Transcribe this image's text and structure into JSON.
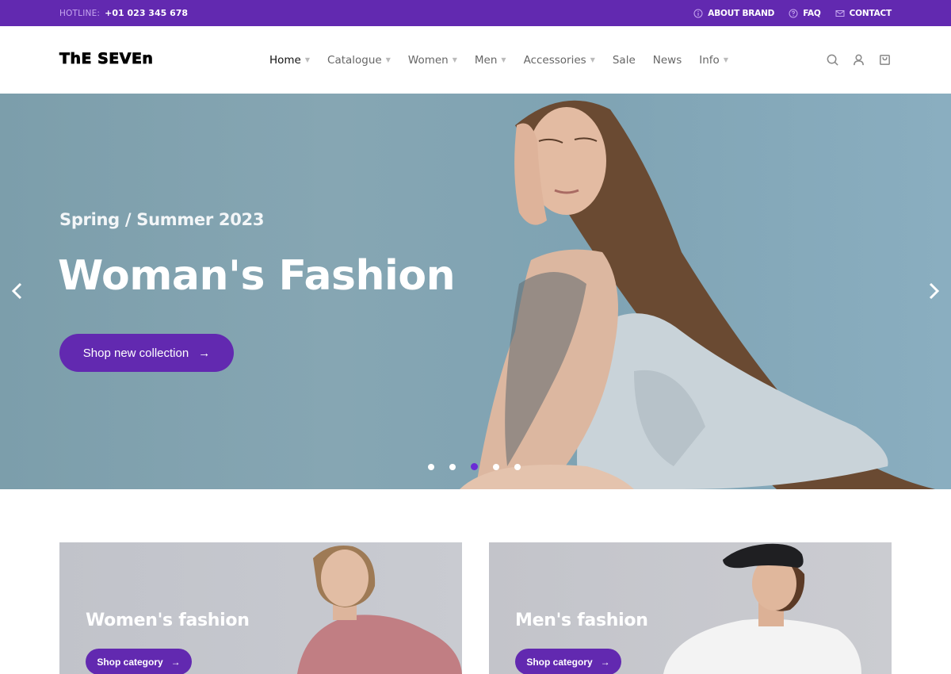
{
  "topbar": {
    "hotline_label": "HOTLINE:",
    "hotline_number": "+01 023 345 678",
    "links": [
      {
        "label": "ABOUT BRAND",
        "icon": "info-icon"
      },
      {
        "label": "FAQ",
        "icon": "question-icon"
      },
      {
        "label": "CONTACT",
        "icon": "mail-icon"
      }
    ]
  },
  "header": {
    "logo": "ThE SEVEn",
    "nav": [
      {
        "label": "Home",
        "dropdown": true,
        "active": true
      },
      {
        "label": "Catalogue",
        "dropdown": true
      },
      {
        "label": "Women",
        "dropdown": true
      },
      {
        "label": "Men",
        "dropdown": true
      },
      {
        "label": "Accessories",
        "dropdown": true
      },
      {
        "label": "Sale",
        "dropdown": false
      },
      {
        "label": "News",
        "dropdown": false
      },
      {
        "label": "Info",
        "dropdown": true
      }
    ],
    "icons": [
      "search-icon",
      "user-icon",
      "cart-icon"
    ]
  },
  "hero": {
    "subtitle": "Spring / Summer 2023",
    "title": "Woman's Fashion",
    "cta_label": "Shop new collection",
    "cta_arrow": "→",
    "slides_total": 5,
    "active_slide": 3
  },
  "categories": [
    {
      "title": "Women's fashion",
      "button_label": "Shop category",
      "arrow": "→"
    },
    {
      "title": "Men's fashion",
      "button_label": "Shop category",
      "arrow": "→"
    }
  ],
  "colors": {
    "brand": "#6229b0",
    "active_dot": "#6a2cd6",
    "hero_bg": "#86a6b3"
  }
}
